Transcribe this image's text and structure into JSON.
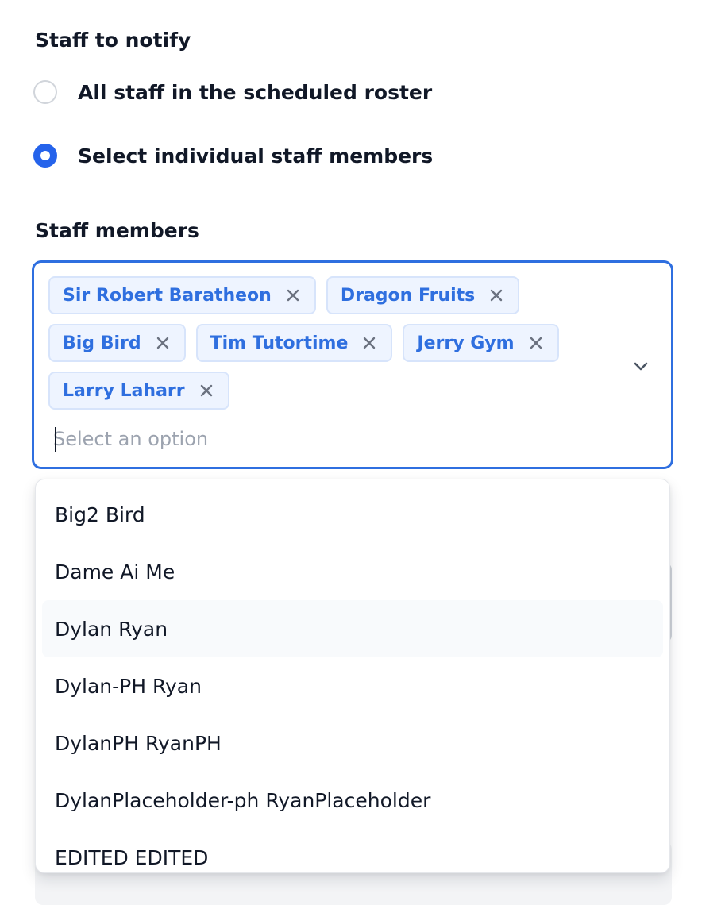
{
  "notify": {
    "title": "Staff to notify",
    "options": [
      {
        "label": "All staff in the scheduled roster",
        "selected": false
      },
      {
        "label": "Select individual staff members",
        "selected": true
      }
    ]
  },
  "staff_members": {
    "label": "Staff members",
    "selected_tags": [
      "Sir Robert Baratheon",
      "Dragon Fruits",
      "Big Bird",
      "Tim Tutortime",
      "Jerry Gym",
      "Larry Laharr"
    ],
    "placeholder": "Select an option",
    "remove_icon": "close-icon",
    "dropdown_icon": "chevron-down-icon"
  },
  "dropdown": {
    "options": [
      "Big2 Bird",
      "Dame Ai Me",
      "Dylan Ryan",
      "Dylan-PH Ryan",
      "DylanPH RyanPH",
      "DylanPlaceholder-ph RyanPlaceholder",
      "EDITED EDITED"
    ],
    "hovered_option": "Dylan Ryan"
  },
  "colors": {
    "accent": "#2563eb",
    "focus_border": "#2f6fe0",
    "tag_text": "#2f6fdf",
    "tag_background": "#eef4ff",
    "tag_border": "#d7e4fb",
    "placeholder": "#9ca3af",
    "hover_row": "#f8fafc"
  }
}
